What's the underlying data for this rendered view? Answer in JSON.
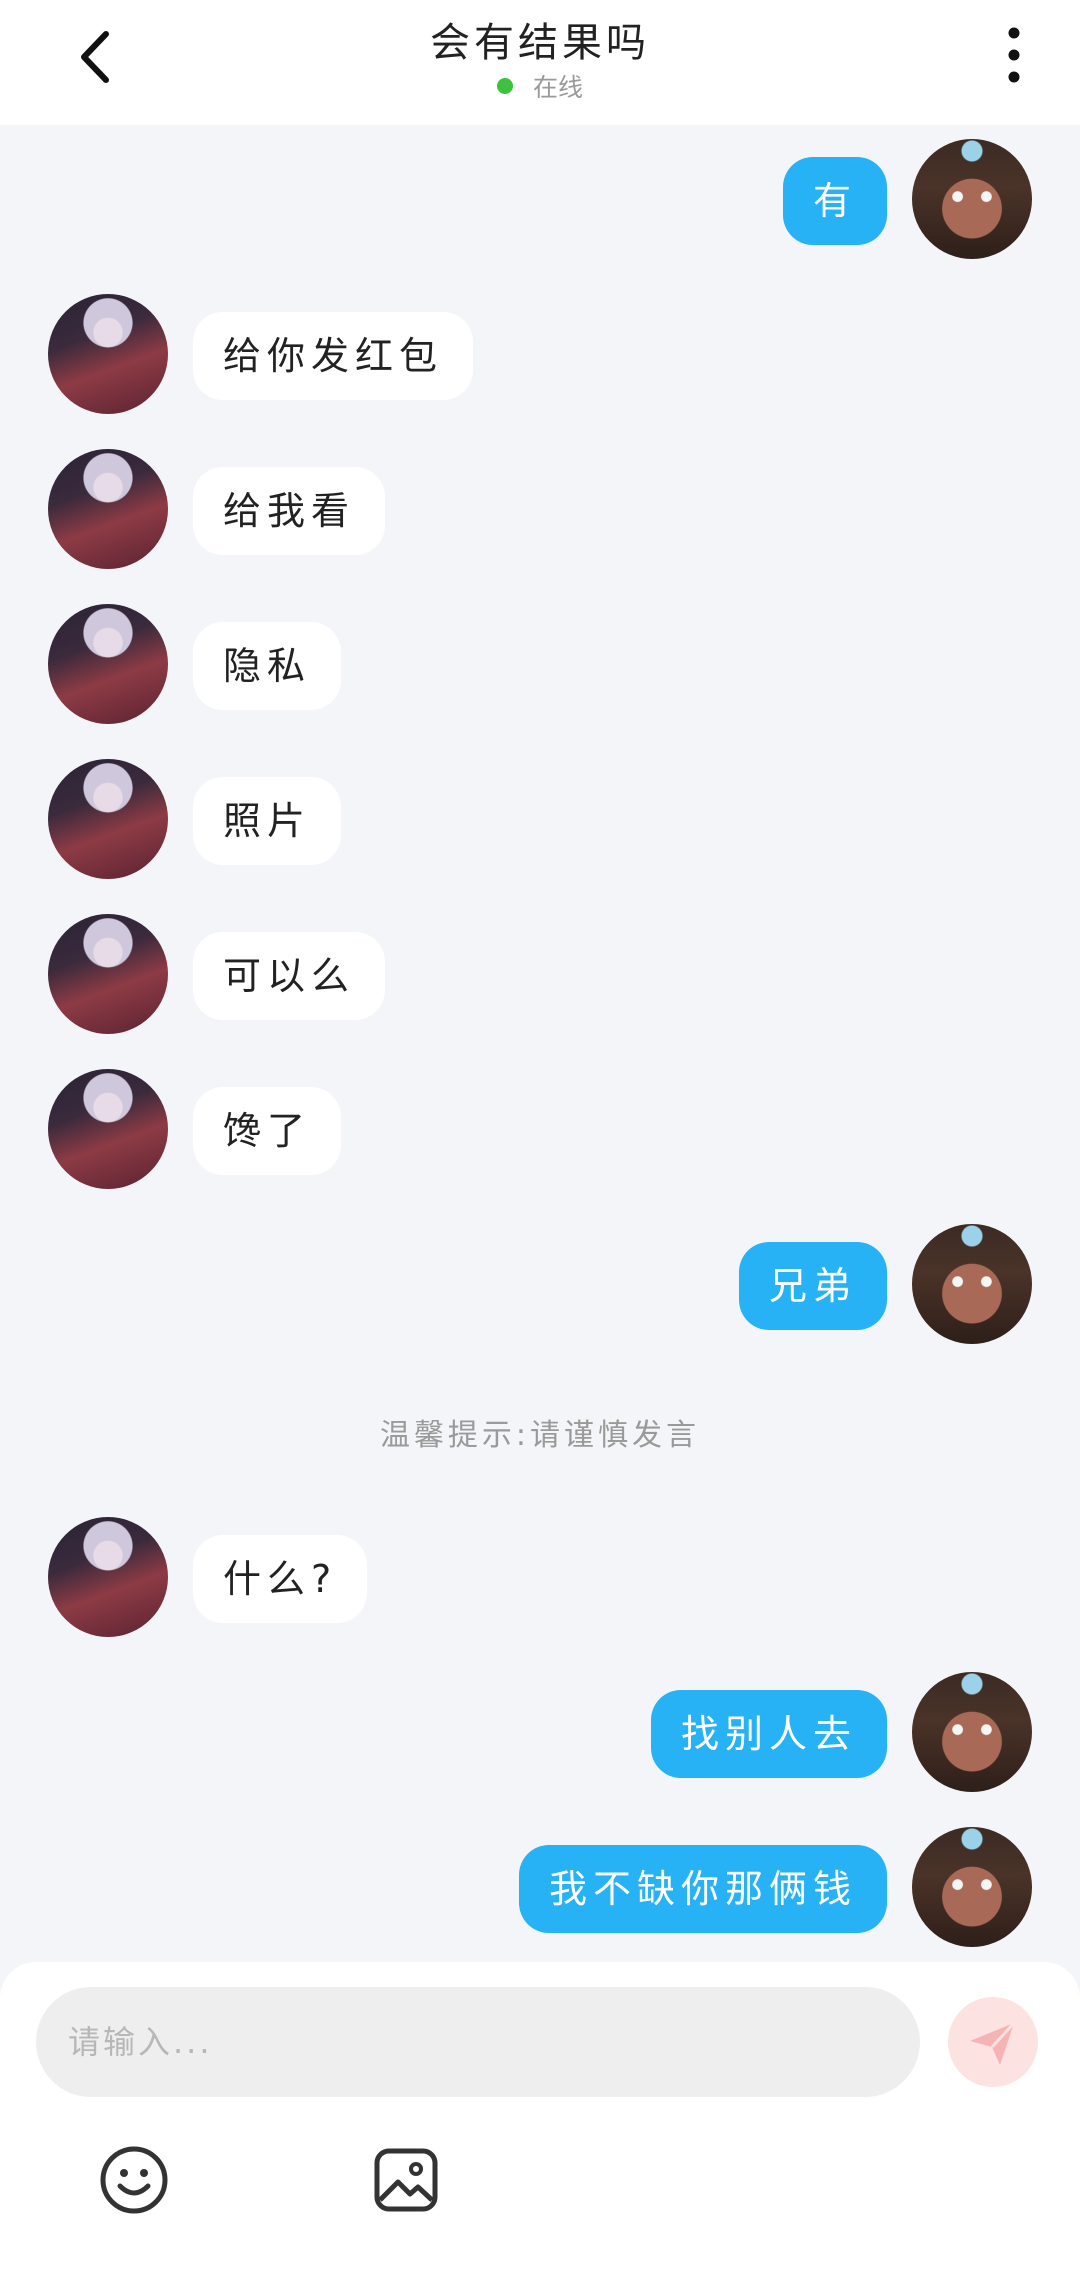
{
  "header": {
    "title": "会有结果吗",
    "status": "在线",
    "status_color": "#3cc23c"
  },
  "messages": [
    {
      "side": "out",
      "text": "有"
    },
    {
      "side": "in",
      "text": "给你发红包"
    },
    {
      "side": "in",
      "text": "给我看"
    },
    {
      "side": "in",
      "text": "隐私"
    },
    {
      "side": "in",
      "text": "照片"
    },
    {
      "side": "in",
      "text": "可以么"
    },
    {
      "side": "in",
      "text": "馋了"
    },
    {
      "side": "out",
      "text": "兄弟"
    },
    {
      "side": "in",
      "text": "什么?"
    },
    {
      "side": "out",
      "text": "找别人去"
    },
    {
      "side": "out",
      "text": "我不缺你那俩钱"
    }
  ],
  "notice": "温馨提示:请谨慎发言",
  "composer": {
    "placeholder": "请输入...",
    "send_icon": "paper-plane-icon",
    "tools": [
      "emoji-icon",
      "image-icon"
    ]
  },
  "colors": {
    "outgoing_bubble": "#26b2f4",
    "incoming_bubble": "#ffffff",
    "background": "#f4f5f8"
  }
}
